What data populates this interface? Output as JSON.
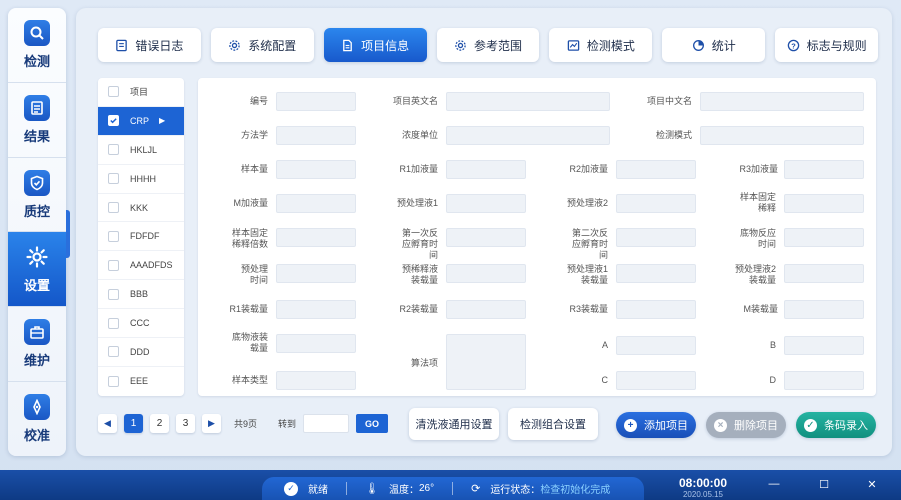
{
  "nav": {
    "items": [
      {
        "label": "检测",
        "icon": "search-icon",
        "active": false
      },
      {
        "label": "结果",
        "icon": "list-icon",
        "active": false
      },
      {
        "label": "质控",
        "icon": "shield-icon",
        "active": false
      },
      {
        "label": "设置",
        "icon": "gear-icon",
        "active": true
      },
      {
        "label": "维护",
        "icon": "toolbox-icon",
        "active": false
      },
      {
        "label": "校准",
        "icon": "compass-icon",
        "active": false
      }
    ]
  },
  "tabs": [
    {
      "label": "错误日志",
      "icon": "log-icon",
      "active": false
    },
    {
      "label": "系统配置",
      "icon": "gear-icon",
      "active": false
    },
    {
      "label": "项目信息",
      "icon": "document-icon",
      "active": true
    },
    {
      "label": "参考范围",
      "icon": "gear-icon",
      "active": false
    },
    {
      "label": "检测模式",
      "icon": "chart-icon",
      "active": false
    },
    {
      "label": "统计",
      "icon": "pie-chart-icon",
      "active": false
    },
    {
      "label": "标志与规则",
      "icon": "help-icon",
      "active": false
    }
  ],
  "project_list": {
    "header": "项目",
    "items": [
      {
        "label": "CRP",
        "selected": true
      },
      {
        "label": "HKLJL",
        "selected": false
      },
      {
        "label": "HHHH",
        "selected": false
      },
      {
        "label": "KKK",
        "selected": false
      },
      {
        "label": "FDFDF",
        "selected": false
      },
      {
        "label": "AAADFDS",
        "selected": false
      },
      {
        "label": "BBB",
        "selected": false
      },
      {
        "label": "CCC",
        "selected": false
      },
      {
        "label": "DDD",
        "selected": false
      },
      {
        "label": "EEE",
        "selected": false
      }
    ]
  },
  "form": {
    "fields": {
      "code": "编号",
      "name_en": "项目英文名",
      "name_cn": "项目中文名",
      "method": "方法学",
      "conc_unit": "浓度单位",
      "detect_mode": "检测模式",
      "sample_vol": "样本量",
      "r1_vol": "R1加液量",
      "r2_vol": "R2加液量",
      "r3_vol": "R3加液量",
      "m_vol": "M加液量",
      "pretreat1": "预处理液1",
      "pretreat2": "预处理液2",
      "sample_fixed_dilution": "样本固定稀释",
      "sample_dilution_factor": "样本固定稀释倍数",
      "first_incubation": "第一次反应孵育时间",
      "second_incubation": "第二次反应孵育时间",
      "substrate_time": "底物反应时间",
      "pretreat_time": "预处理时间",
      "prediluent_load": "预稀释液装载量",
      "pretreat1_load": "预处理液1装载量",
      "pretreat2_load": "预处理液2装载量",
      "r1_load": "R1装载量",
      "r2_load": "R2装载量",
      "r3_load": "R3装载量",
      "m_load": "M装载量",
      "substrate_load": "底物液装载量",
      "algorithm": "算法项",
      "a": "A",
      "b": "B",
      "c": "C",
      "d": "D",
      "sample_type": "样本类型"
    }
  },
  "pager": {
    "pages": [
      "1",
      "2",
      "3"
    ],
    "current": "1",
    "total": "共9页",
    "goto": "转到",
    "go": "GO"
  },
  "buttons": {
    "wash_settings": "清洗液通用设置",
    "combo_settings": "检测组合设置",
    "add_item": "添加项目",
    "delete_item": "删除项目",
    "barcode_entry": "条码录入"
  },
  "status": {
    "ready": "就绪",
    "temperature_label": "温度：",
    "temperature_value": "26°",
    "run_label": "运行状态：",
    "run_value": "检查初始化完成",
    "time": "08:00:00",
    "date": "2020.05.15"
  },
  "colors": {
    "primary": "#1d64d4",
    "teal": "#11907f",
    "grey": "#a5afbd"
  }
}
